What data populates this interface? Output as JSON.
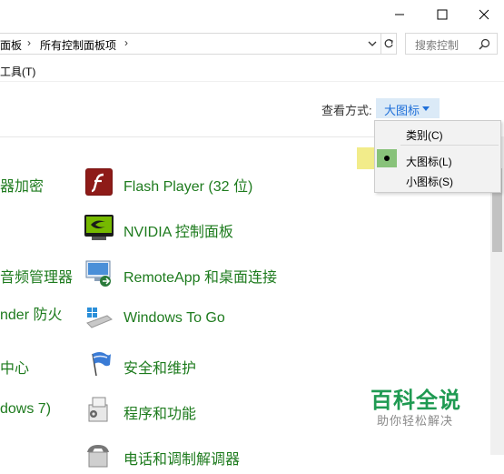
{
  "window": {
    "min_icon": "minimize-icon",
    "max_icon": "maximize-icon",
    "close_icon": "close-icon"
  },
  "address": {
    "crumbs": [
      "面板",
      "所有控制面板项"
    ],
    "separator": "›",
    "dropdown_icon": "chevron-down-icon",
    "refresh_icon": "refresh-icon"
  },
  "search": {
    "placeholder": "搜索控制",
    "icon": "search-icon"
  },
  "menu": {
    "tools": "工具(T)"
  },
  "view": {
    "label": "查看方式:",
    "selected": "大图标",
    "options": [
      "类别(C)",
      "大图标(L)",
      "小图标(S)"
    ],
    "checked_index": 1
  },
  "left_items": [
    "器加密",
    "音频管理器",
    "nder 防火",
    "中心",
    "dows 7)"
  ],
  "items": [
    {
      "label": "Flash Player (32 位)",
      "icon": "flash-player-icon"
    },
    {
      "label": "NVIDIA 控制面板",
      "icon": "nvidia-icon"
    },
    {
      "label": "RemoteApp 和桌面连接",
      "icon": "remoteapp-icon"
    },
    {
      "label": "Windows To Go",
      "icon": "windows-to-go-icon"
    },
    {
      "label": "安全和维护",
      "icon": "security-flag-icon"
    },
    {
      "label": "程序和功能",
      "icon": "programs-icon"
    },
    {
      "label": "电话和调制解调器",
      "icon": "phone-modem-icon"
    }
  ],
  "watermark": {
    "title": "百科全说",
    "subtitle": "助你轻松解决"
  },
  "colors": {
    "link_green": "#1e7b1e",
    "accent_blue": "#1e6fd9",
    "highlight_yellow": "#f2ec8a",
    "watermark_green": "#1f9a52"
  }
}
